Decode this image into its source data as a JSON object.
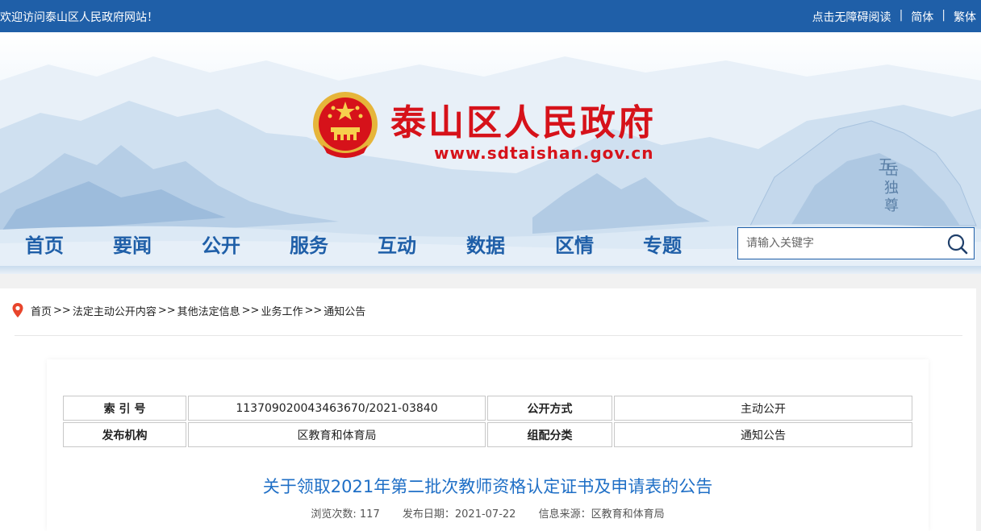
{
  "topbar": {
    "welcome": "欢迎访问泰山区人民政府网站！",
    "accessible": "点击无障碍阅读",
    "separator": "|",
    "simplified": "简体",
    "traditional": "繁体"
  },
  "banner": {
    "title": "泰山区人民政府",
    "url": "www.sdtaishan.gov.cn",
    "inscription": "五岳独尊"
  },
  "nav": {
    "items": [
      "首页",
      "要闻",
      "公开",
      "服务",
      "互动",
      "数据",
      "区情",
      "专题"
    ]
  },
  "search": {
    "placeholder": "请输入关键字"
  },
  "breadcrumb": {
    "items": [
      "首页",
      "法定主动公开内容",
      "其他法定信息",
      "业务工作",
      "通知公告"
    ],
    "separator": ">>"
  },
  "meta_table": {
    "rows": [
      [
        "索 引 号",
        "113709020043463670/2021-03840",
        "公开方式",
        "主动公开"
      ],
      [
        "发布机构",
        "区教育和体育局",
        "组配分类",
        "通知公告"
      ]
    ]
  },
  "article": {
    "title": "关于领取2021年第二批次教师资格认定证书及申请表的公告",
    "views_label": "浏览次数:",
    "views": "117",
    "date_label": "发布日期：",
    "date": "2021-07-22",
    "source_label": "信息来源：",
    "source": "区教育和体育局"
  },
  "colors": {
    "brand_blue": "#1f5fa8",
    "title_red": "#d6121a",
    "article_blue": "#1f6fc6"
  }
}
